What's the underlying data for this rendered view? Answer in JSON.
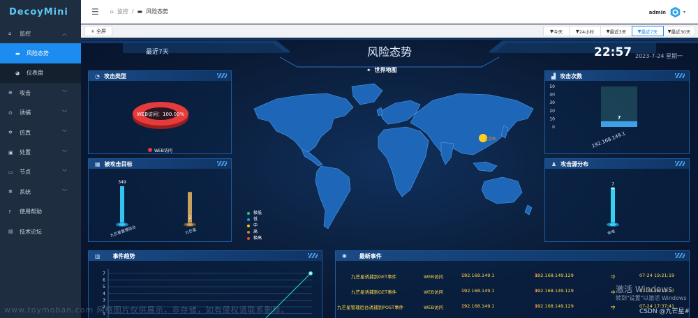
{
  "app": {
    "logo": "DecoyMini"
  },
  "sidebar": {
    "items": [
      {
        "label": "监控",
        "icon": "home-icon",
        "expanded": true
      },
      {
        "label": "风险态势",
        "icon": "monitor-icon",
        "sub": true,
        "active": true
      },
      {
        "label": "仪表盘",
        "icon": "dashboard-icon",
        "sub": true
      },
      {
        "label": "攻击",
        "icon": "target-icon",
        "expanded": false
      },
      {
        "label": "诱捕",
        "icon": "trap-icon",
        "expanded": false
      },
      {
        "label": "仿真",
        "icon": "gear-icon",
        "expanded": false
      },
      {
        "label": "处置",
        "icon": "lock-icon",
        "expanded": false
      },
      {
        "label": "节点",
        "icon": "desktop-icon",
        "expanded": false
      },
      {
        "label": "系统",
        "icon": "settings-icon",
        "expanded": false
      },
      {
        "label": "使用帮助",
        "icon": "help-icon"
      },
      {
        "label": "技术论坛",
        "icon": "chat-icon"
      }
    ]
  },
  "header": {
    "breadcrumb": [
      "监控",
      "风险态势"
    ],
    "user": "admin"
  },
  "toolbar": {
    "fullscreen": "+ 全屏",
    "ranges": [
      "今天",
      "24小时",
      "最近3天",
      "最近7天",
      "最近30天"
    ],
    "selected_range": "最近7天"
  },
  "dashboard": {
    "title": "风险态势",
    "period": "最近7天",
    "time": "22:57",
    "date": "2023-7-24 星期一",
    "map_title": "世界地图",
    "map_marker": "北京市",
    "legend": [
      {
        "label": "极低",
        "color": "#2ecc71"
      },
      {
        "label": "低",
        "color": "#3498db"
      },
      {
        "label": "中",
        "color": "#f1c40f"
      },
      {
        "label": "高",
        "color": "#e67e22"
      },
      {
        "label": "极高",
        "color": "#e74c3c"
      }
    ],
    "attack_type": {
      "title": "攻击类型",
      "slice_label": "WEB访问：100.00%",
      "legend": "WEB访问",
      "color": "#e53b3b"
    },
    "targets": {
      "title": "被攻击目标"
    },
    "attack_count": {
      "title": "攻击次数"
    },
    "source_dist": {
      "title": "攻击源分布"
    },
    "trend": {
      "title": "事件趋势"
    },
    "events": {
      "title": "最新事件",
      "rows": [
        {
          "event": "九芒星诱捕到GET事件",
          "type": "WEB访问",
          "src": "192.168.149.1",
          "dst": "192.168.149.129",
          "level": "中",
          "time": "07-24 19:21:19"
        },
        {
          "event": "九芒星诱捕到GET事件",
          "type": "WEB访问",
          "src": "192.168.149.1",
          "dst": "192.168.149.129",
          "level": "中",
          "time": "07-24 18:12:17"
        },
        {
          "event": "九芒星管理后台诱捕到POST事件",
          "type": "WEB访问",
          "src": "192.168.149.1",
          "dst": "192.168.149.129",
          "level": "中",
          "time": "07-24 17:37:41"
        }
      ]
    }
  },
  "chart_data": [
    {
      "type": "pie",
      "title": "攻击类型",
      "categories": [
        "WEB访问"
      ],
      "values": [
        100
      ]
    },
    {
      "type": "bar",
      "title": "被攻击目标",
      "categories": [
        "九芒星管理后台",
        "九芒星"
      ],
      "values": [
        349,
        2
      ]
    },
    {
      "type": "bar",
      "title": "攻击次数",
      "categories": [
        "192.168.149.1"
      ],
      "values": [
        7
      ],
      "ylim": [
        0,
        50
      ],
      "yticks": [
        0,
        10,
        20,
        30,
        40,
        50
      ]
    },
    {
      "type": "bar",
      "title": "攻击源分布",
      "categories": [
        "本地"
      ],
      "values": [
        7
      ]
    },
    {
      "type": "line",
      "title": "事件趋势",
      "yticks": [
        1,
        2,
        3,
        4,
        5,
        6,
        7
      ]
    }
  ],
  "watermarks": {
    "activate1": "激活 Windows",
    "activate2": "转到\"设置\"以激活 Windows",
    "csdn": "CSDN @九芒星#",
    "url": "www.toymoban.com 网络图片仅供展示，非存储，如有侵权请联系删除。"
  }
}
